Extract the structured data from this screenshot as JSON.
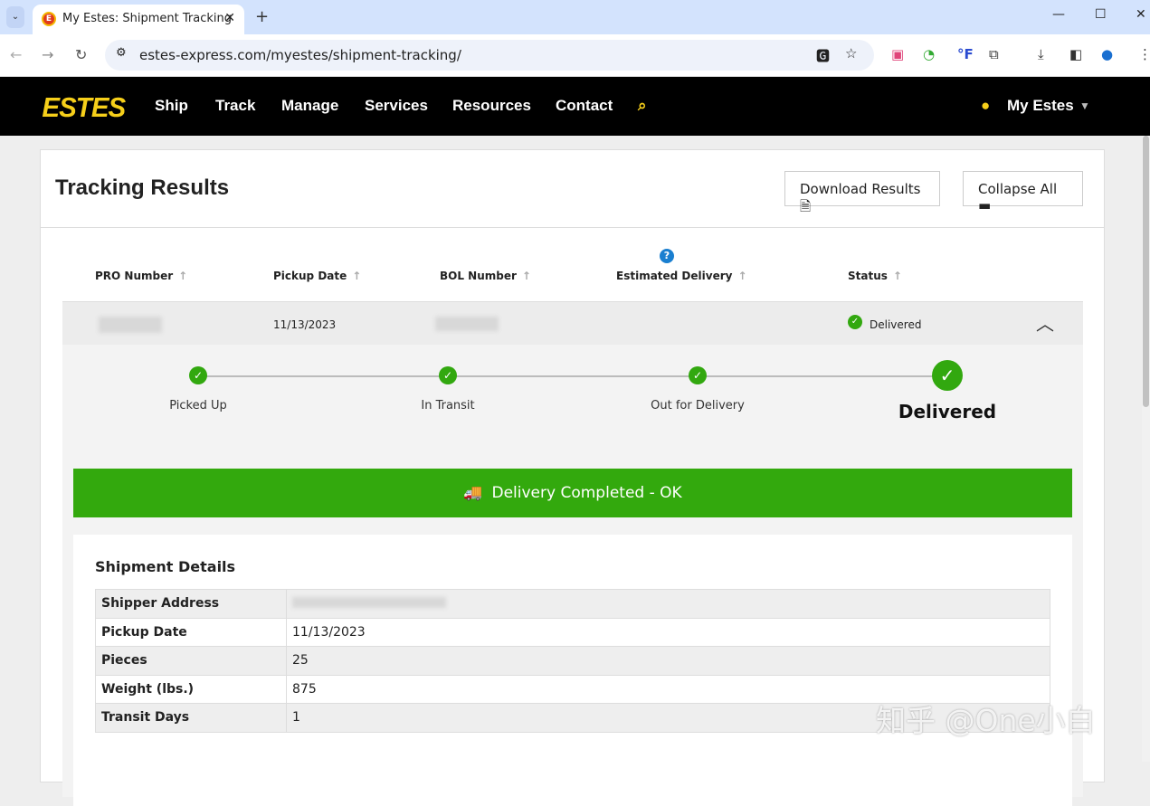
{
  "browser": {
    "tab_title": "My Estes: Shipment Tracking",
    "url": "estes-express.com/myestes/shipment-tracking/"
  },
  "nav": {
    "logo": "ESTES",
    "items": [
      "Ship",
      "Track",
      "Manage",
      "Services",
      "Resources",
      "Contact"
    ],
    "account": "My Estes"
  },
  "results": {
    "title": "Tracking Results",
    "download": "Download Results",
    "collapse": "Collapse All",
    "columns": [
      "PRO Number",
      "Pickup Date",
      "BOL Number",
      "Estimated Delivery",
      "Status"
    ],
    "row": {
      "pickup_date": "11/13/2023",
      "status": "Delivered"
    },
    "steps": [
      "Picked Up",
      "In Transit",
      "Out for Delivery",
      "Delivered"
    ],
    "banner": "Delivery Completed - OK",
    "details": {
      "title": "Shipment Details",
      "rows": [
        {
          "label": "Shipper Address",
          "value": ""
        },
        {
          "label": "Pickup Date",
          "value": "11/13/2023"
        },
        {
          "label": "Pieces",
          "value": "25"
        },
        {
          "label": "Weight (lbs.)",
          "value": "875"
        },
        {
          "label": "Transit Days",
          "value": "1"
        }
      ]
    }
  },
  "watermark": "知乎 @One小白",
  "colors": {
    "green": "#33a90d",
    "logo": "#f6cf1a"
  }
}
